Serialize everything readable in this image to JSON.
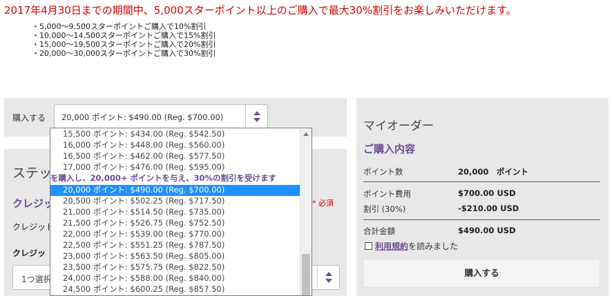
{
  "promo": {
    "title": "2017年4月30日までの期間中、5,000スターポイント以上のご購入で最大30%割引をお楽しみいただけます。",
    "tiers": [
      "・5,000～9,500スターポイントご購入で10%割引",
      "・10,000～14,500スターポイントご購入で15%割引",
      "・15,000～19,500スターポイントご購入で20%割引",
      "・20,000～30,000スターポイントご購入で30%割引"
    ]
  },
  "purchase": {
    "label": "購入する",
    "selected_value": "20,000 ポイント: $490.00 (Reg. $700.00)"
  },
  "dropdown": {
    "rows": [
      {
        "text": "15,500 ポイント: $434.00 (Reg. $542.50)",
        "kind": "option"
      },
      {
        "text": "16,000 ポイント: $448.00 (Reg. $560.00)",
        "kind": "option"
      },
      {
        "text": "16,500 ポイント: $462.00 (Reg. $577.50)",
        "kind": "option"
      },
      {
        "text": "17,000 ポイント: $476.00 (Reg. $595.00)",
        "kind": "option"
      },
      {
        "text": "を購入し、20,000+ ポイントを与え、30%の割引を受けます",
        "kind": "group"
      },
      {
        "text": "20,000 ポイント: $490.00 (Reg. $700.00)",
        "kind": "selected"
      },
      {
        "text": "20,500 ポイント: $502.25 (Reg. $717.50)",
        "kind": "option"
      },
      {
        "text": "21,000 ポイント: $514.50 (Reg. $735.00)",
        "kind": "option"
      },
      {
        "text": "21,500 ポイント: $526.75 (Reg. $752.50)",
        "kind": "option"
      },
      {
        "text": "22,000 ポイント: $539.00 (Reg. $770.00)",
        "kind": "option"
      },
      {
        "text": "22,500 ポイント: $551.25 (Reg. $787.50)",
        "kind": "option"
      },
      {
        "text": "23,000 ポイント: $563.50 (Reg. $805.00)",
        "kind": "option"
      },
      {
        "text": "23,500 ポイント: $575.75 (Reg. $822.50)",
        "kind": "option"
      },
      {
        "text": "24,000 ポイント: $588.00 (Reg. $840.00)",
        "kind": "option"
      },
      {
        "text": "24,500 ポイント: $600.25 (Reg. $857.50)",
        "kind": "option"
      }
    ]
  },
  "step": {
    "title": "ステッ",
    "credit_head": "クレジッ",
    "required": "* 必須",
    "credit_label1": "クレジット",
    "credit_label2": "クレジッ",
    "select_value": "1つ選択"
  },
  "order": {
    "title": "マイオーダー",
    "contents_head": "ご購入内容",
    "points_label": "ポイント数",
    "points_value": "20,000　ポイント",
    "cost_label": "ポイント費用",
    "cost_value": "$700.00 USD",
    "discount_label": "割引 (30%)",
    "discount_value": "-$210.00 USD",
    "total_label": "合計金額",
    "total_value": "$490.00 USD",
    "terms_link": "利用規約",
    "terms_text": "を読みました",
    "buy_button": "購入する"
  }
}
